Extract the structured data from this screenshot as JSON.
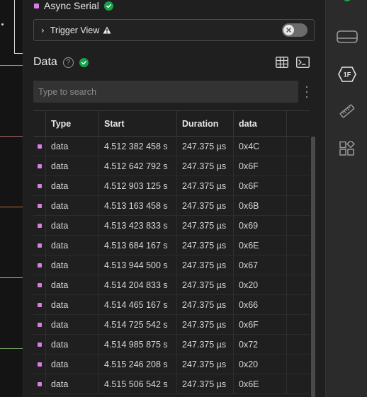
{
  "analyzer": {
    "name": "Async Serial",
    "color": "#d97ee3",
    "status": "ok"
  },
  "trigger": {
    "label": "Trigger View",
    "enabled": false
  },
  "data_section": {
    "title": "Data",
    "help": "?"
  },
  "search": {
    "placeholder": "Type to search",
    "value": ""
  },
  "table": {
    "columns": [
      "Type",
      "Start",
      "Duration",
      "data"
    ],
    "rows": [
      {
        "type": "data",
        "start": "4.512 382 458 s",
        "duration": "247.375 µs",
        "data": "0x4C"
      },
      {
        "type": "data",
        "start": "4.512 642 792 s",
        "duration": "247.375 µs",
        "data": "0x6F"
      },
      {
        "type": "data",
        "start": "4.512 903 125 s",
        "duration": "247.375 µs",
        "data": "0x6F"
      },
      {
        "type": "data",
        "start": "4.513 163 458 s",
        "duration": "247.375 µs",
        "data": "0x6B"
      },
      {
        "type": "data",
        "start": "4.513 423 833 s",
        "duration": "247.375 µs",
        "data": "0x69"
      },
      {
        "type": "data",
        "start": "4.513 684 167 s",
        "duration": "247.375 µs",
        "data": "0x6E"
      },
      {
        "type": "data",
        "start": "4.513 944 500 s",
        "duration": "247.375 µs",
        "data": "0x67"
      },
      {
        "type": "data",
        "start": "4.514 204 833 s",
        "duration": "247.375 µs",
        "data": "0x20"
      },
      {
        "type": "data",
        "start": "4.514 465 167 s",
        "duration": "247.375 µs",
        "data": "0x66"
      },
      {
        "type": "data",
        "start": "4.514 725 542 s",
        "duration": "247.375 µs",
        "data": "0x6F"
      },
      {
        "type": "data",
        "start": "4.514 985 875 s",
        "duration": "247.375 µs",
        "data": "0x72"
      },
      {
        "type": "data",
        "start": "4.515 246 208 s",
        "duration": "247.375 µs",
        "data": "0x20"
      },
      {
        "type": "data",
        "start": "4.515 506 542 s",
        "duration": "247.375 µs",
        "data": "0x6E"
      }
    ]
  },
  "rail": {
    "items": [
      "device-icon",
      "analyzer-icon",
      "measure-icon",
      "extensions-icon"
    ],
    "active": "analyzer-icon",
    "analyzer_badge": "1F"
  },
  "colors": {
    "accent": "#d97ee3",
    "success": "#16a34a",
    "channel_lines": [
      "#c8a070",
      "#c87a7a",
      "#c87a4a",
      "#d0c060",
      "#7aa870"
    ]
  }
}
